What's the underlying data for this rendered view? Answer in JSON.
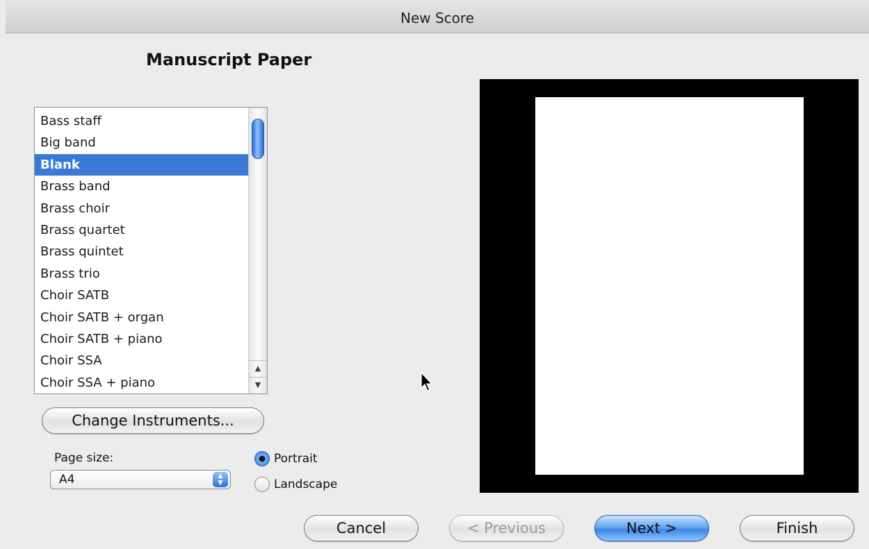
{
  "window": {
    "title": "New Score"
  },
  "section_title": "Manuscript Paper",
  "list": {
    "items": [
      "Bass staff",
      "Big band",
      "Blank",
      "Brass band",
      "Brass choir",
      "Brass quartet",
      "Brass quintet",
      "Brass trio",
      "Choir SATB",
      "Choir SATB + organ",
      "Choir SATB + piano",
      "Choir SSA",
      "Choir SSA + piano"
    ],
    "selected": "Blank"
  },
  "change_instruments_label": "Change Instruments...",
  "page_size": {
    "label": "Page size:",
    "value": "A4"
  },
  "orientation": {
    "portrait_label": "Portrait",
    "landscape_label": "Landscape",
    "selected": "Portrait"
  },
  "footer": {
    "cancel_label": "Cancel",
    "previous_label": "< Previous",
    "next_label": "Next >",
    "finish_label": "Finish"
  },
  "icons": {
    "cursor": "arrow-pointer-icon",
    "scroll_up": "triangle-up-icon",
    "scroll_down": "triangle-down-icon"
  },
  "colors": {
    "selection": "#3a7ad6",
    "default_button": "#5b9ef0",
    "preview_bg": "#000000"
  }
}
